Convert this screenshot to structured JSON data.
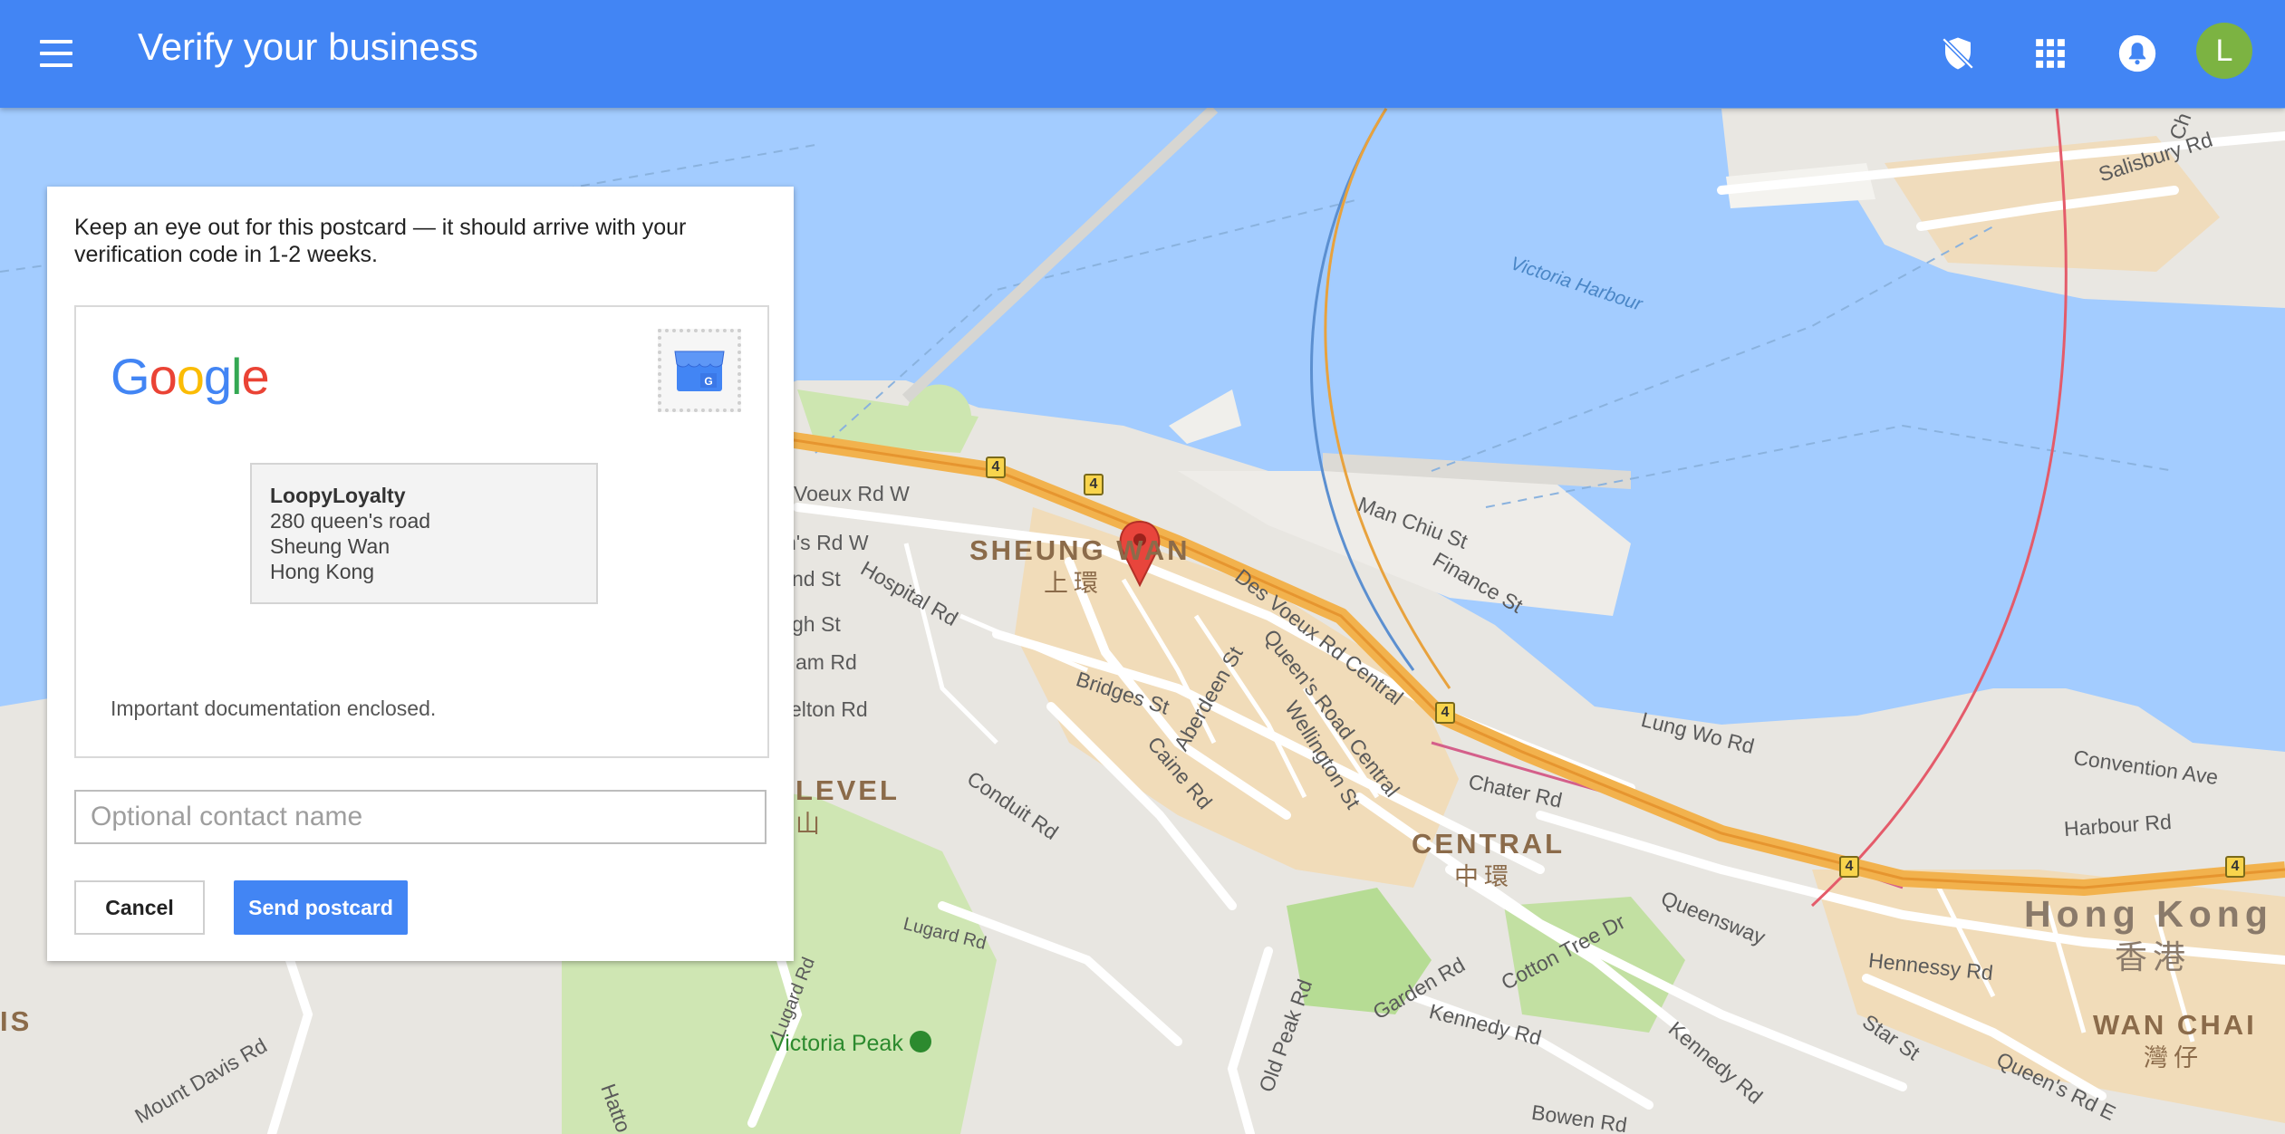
{
  "topbar": {
    "title": "Verify your business",
    "menu_icon": "menu-icon",
    "icons": [
      "shield-off-icon",
      "apps-grid-icon",
      "notifications-bell-icon"
    ],
    "avatar_letter": "L",
    "accent_color": "#4285f4",
    "avatar_color": "#7cb342"
  },
  "dialog": {
    "intro": "Keep an eye out for this postcard — it should arrive with your verification code in 1-2 weeks.",
    "postcard": {
      "logo": "Google",
      "stamp_icon": "google-my-business-icon",
      "address": {
        "name": "LoopyLoyalty",
        "line1": "280 queen's road",
        "line2": "Sheung Wan",
        "line3": "Hong Kong"
      },
      "note": "Important documentation enclosed."
    },
    "contact_placeholder": "Optional contact name",
    "contact_value": "",
    "cancel_label": "Cancel",
    "send_label": "Send postcard"
  },
  "map": {
    "districts": {
      "sheung_wan": "SHEUNG WAN",
      "sheung_wan_zh": "上環",
      "central": "CENTRAL",
      "central_zh": "中環",
      "wan_chai": "WAN CHAI",
      "wan_chai_zh": "灣仔",
      "hong_kong": "Hong Kong",
      "hong_kong_zh": "香港",
      "level": "LEVEL",
      "level_zh": "山",
      "is_fragment": "IS"
    },
    "water": {
      "victoria_harbour": "Victoria Harbour"
    },
    "park": {
      "victoria_peak": "Victoria Peak"
    },
    "roads": {
      "voeux_w": "Voeux Rd W",
      "s_rd_w": "n's Rd W",
      "nd_st": "nd St",
      "gh_st": "gh St",
      "am_rd": "am Rd",
      "elton_rd": "elton Rd",
      "hospital_rd": "Hospital Rd",
      "bridges_st": "Bridges St",
      "aberdeen_st": "Aberdeen St",
      "caine_rd": "Caine Rd",
      "queens_road_central": "Queen's Road Central",
      "wellington_st": "Wellington St",
      "des_voeux_rd_central": "Des Voeux Rd Central",
      "man_chiu_st": "Man Chiu St",
      "finance_st": "Finance St",
      "chater_rd": "Chater Rd",
      "lung_wo_rd": "Lung Wo Rd",
      "convention_ave": "Convention Ave",
      "harbour_rd": "Harbour Rd",
      "queensway": "Queensway",
      "hennessy_rd": "Hennessy Rd",
      "star_st": "Star St",
      "queens_rd_e": "Queen's Rd E",
      "cotton_tree_dr": "Cotton Tree Dr",
      "garden_rd": "Garden Rd",
      "kennedy_rd": "Kennedy Rd",
      "kennedy_rd_2": "Kennedy Rd",
      "old_peak_rd": "Old Peak Rd",
      "bowen_rd": "Bowen Rd",
      "conduit_rd": "Conduit Rd",
      "lugard_rd": "Lugard Rd",
      "lugard_rd_2": "Lugard Rd",
      "mount_davis_rd": "Mount Davis Rd",
      "hatton_rd": "Hatto",
      "salisbury_rd": "Salisbury Rd",
      "ch_fragment": "Ch"
    },
    "highway_number": "4",
    "pin_icon": "map-pin-icon"
  }
}
